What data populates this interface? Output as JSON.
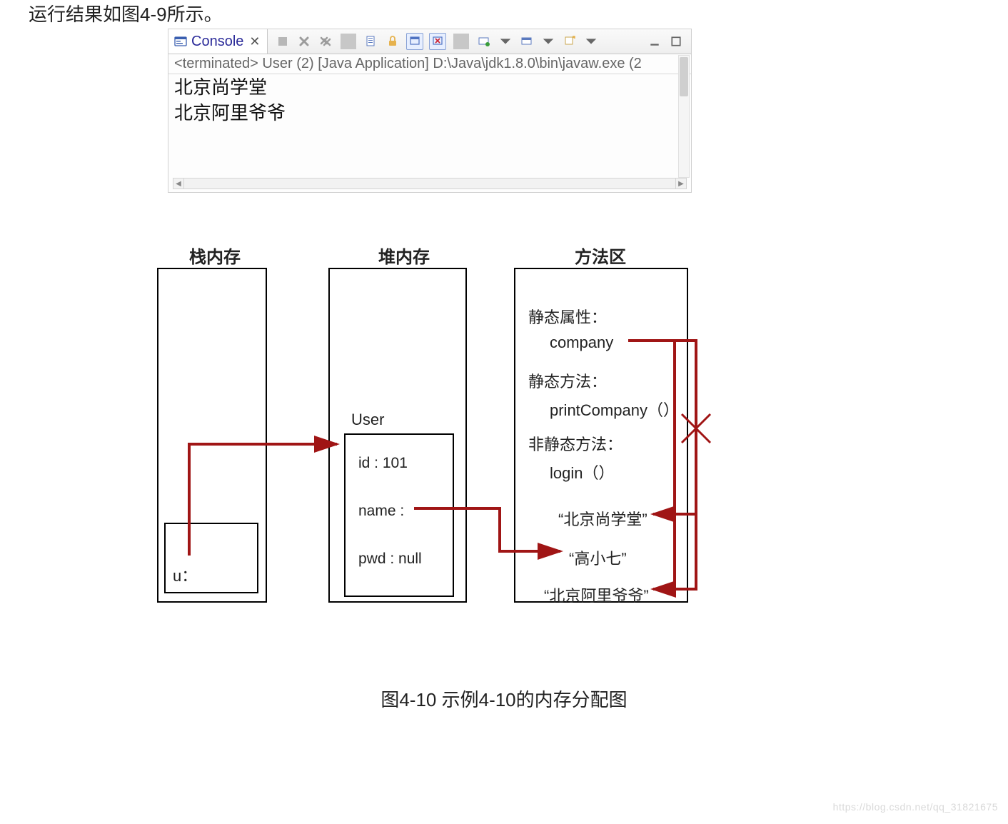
{
  "intro_text": "运行结果如图4-9所示。",
  "console": {
    "tab_label": "Console",
    "terminated_line": "<terminated> User (2) [Java Application] D:\\Java\\jdk1.8.0\\bin\\javaw.exe (2",
    "output_lines": [
      "北京尚学堂",
      "北京阿里爷爷"
    ]
  },
  "diagram": {
    "columns": {
      "stack": "栈内存",
      "heap": "堆内存",
      "method_area": "方法区"
    },
    "stack_var": "u：",
    "heap_name": "User",
    "heap_fields": {
      "id": "id : 101",
      "name": "name :",
      "pwd": "pwd : null"
    },
    "method_area": {
      "static_prop_label": "静态属性：",
      "static_prop": "company",
      "static_method_label": "静态方法：",
      "static_method": "printCompany（）",
      "nonstatic_method_label": "非静态方法：",
      "nonstatic_method": "login（）",
      "literals": [
        "“北京尚学堂”",
        "“高小七”",
        "“北京阿里爷爷”"
      ]
    }
  },
  "caption": "图4-10 示例4-10的内存分配图",
  "watermark": "https://blog.csdn.net/qq_31821675"
}
